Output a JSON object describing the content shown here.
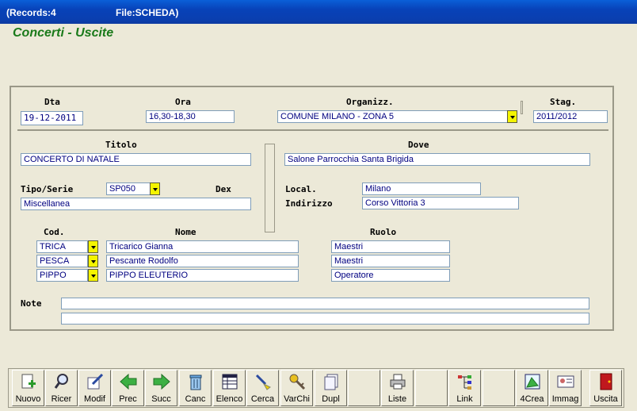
{
  "window": {
    "records": "(Records:4",
    "file": "File:SCHEDA)"
  },
  "form_title": "Concerti - Uscite",
  "fields": {
    "dta_label": "Dta",
    "dta": "19-12-2011",
    "ora_label": "Ora",
    "ora": "16,30-18,30",
    "organizz_label": "Organizz.",
    "organizz": "COMUNE MILANO - ZONA 5",
    "stag_label": "Stag.",
    "stag": "2011/2012",
    "titolo_label": "Titolo",
    "titolo": "CONCERTO DI NATALE",
    "dove_label": "Dove",
    "dove": "Salone Parrocchia Santa Brigida",
    "tipo_label": "Tipo/Serie",
    "tipo": "SP050",
    "dex_label": "Dex",
    "dex": "Miscellanea",
    "local_label": "Local.",
    "local": "Milano",
    "indirizzo_label": "Indirizzo",
    "indirizzo": "Corso Vittoria 3",
    "note_label": "Note",
    "note1": "",
    "note2": ""
  },
  "table": {
    "headers": {
      "cod": "Cod.",
      "nome": "Nome",
      "ruolo": "Ruolo"
    },
    "rows": [
      {
        "cod": "TRICA",
        "nome": "Tricarico Gianna",
        "ruolo": "Maestri"
      },
      {
        "cod": "PESCA",
        "nome": "Pescante Rodolfo",
        "ruolo": "Maestri"
      },
      {
        "cod": "PIPPO",
        "nome": "PIPPO ELEUTERIO",
        "ruolo": "Operatore"
      }
    ]
  },
  "toolbar": [
    {
      "label": "Nuovo",
      "icon": "new-doc-icon"
    },
    {
      "label": "Ricer",
      "icon": "search-icon"
    },
    {
      "label": "Modif",
      "icon": "edit-icon"
    },
    {
      "label": "Prec",
      "icon": "arrow-left-icon"
    },
    {
      "label": "Succ",
      "icon": "arrow-right-icon"
    },
    {
      "label": "Canc",
      "icon": "trash-icon"
    },
    {
      "label": "Elenco",
      "icon": "list-icon"
    },
    {
      "label": "Cerca",
      "icon": "brush-icon"
    },
    {
      "label": "VarChi",
      "icon": "keys-icon"
    },
    {
      "label": "Dupl",
      "icon": "duplicate-icon"
    },
    {
      "label": "",
      "icon": ""
    },
    {
      "label": "Liste",
      "icon": "printer-icon"
    },
    {
      "label": "",
      "icon": ""
    },
    {
      "label": "Link",
      "icon": "link-icon"
    },
    {
      "label": "",
      "icon": ""
    },
    {
      "label": "4Crea",
      "icon": "create-icon"
    },
    {
      "label": "Immag",
      "icon": "id-card-icon"
    },
    {
      "label": "Uscita",
      "icon": "exit-door-icon"
    }
  ],
  "colors": {
    "titlebar": "#0842b8",
    "title_text": "#1a7a1a",
    "field_text": "#000080",
    "dropdown": "#f4f400"
  }
}
